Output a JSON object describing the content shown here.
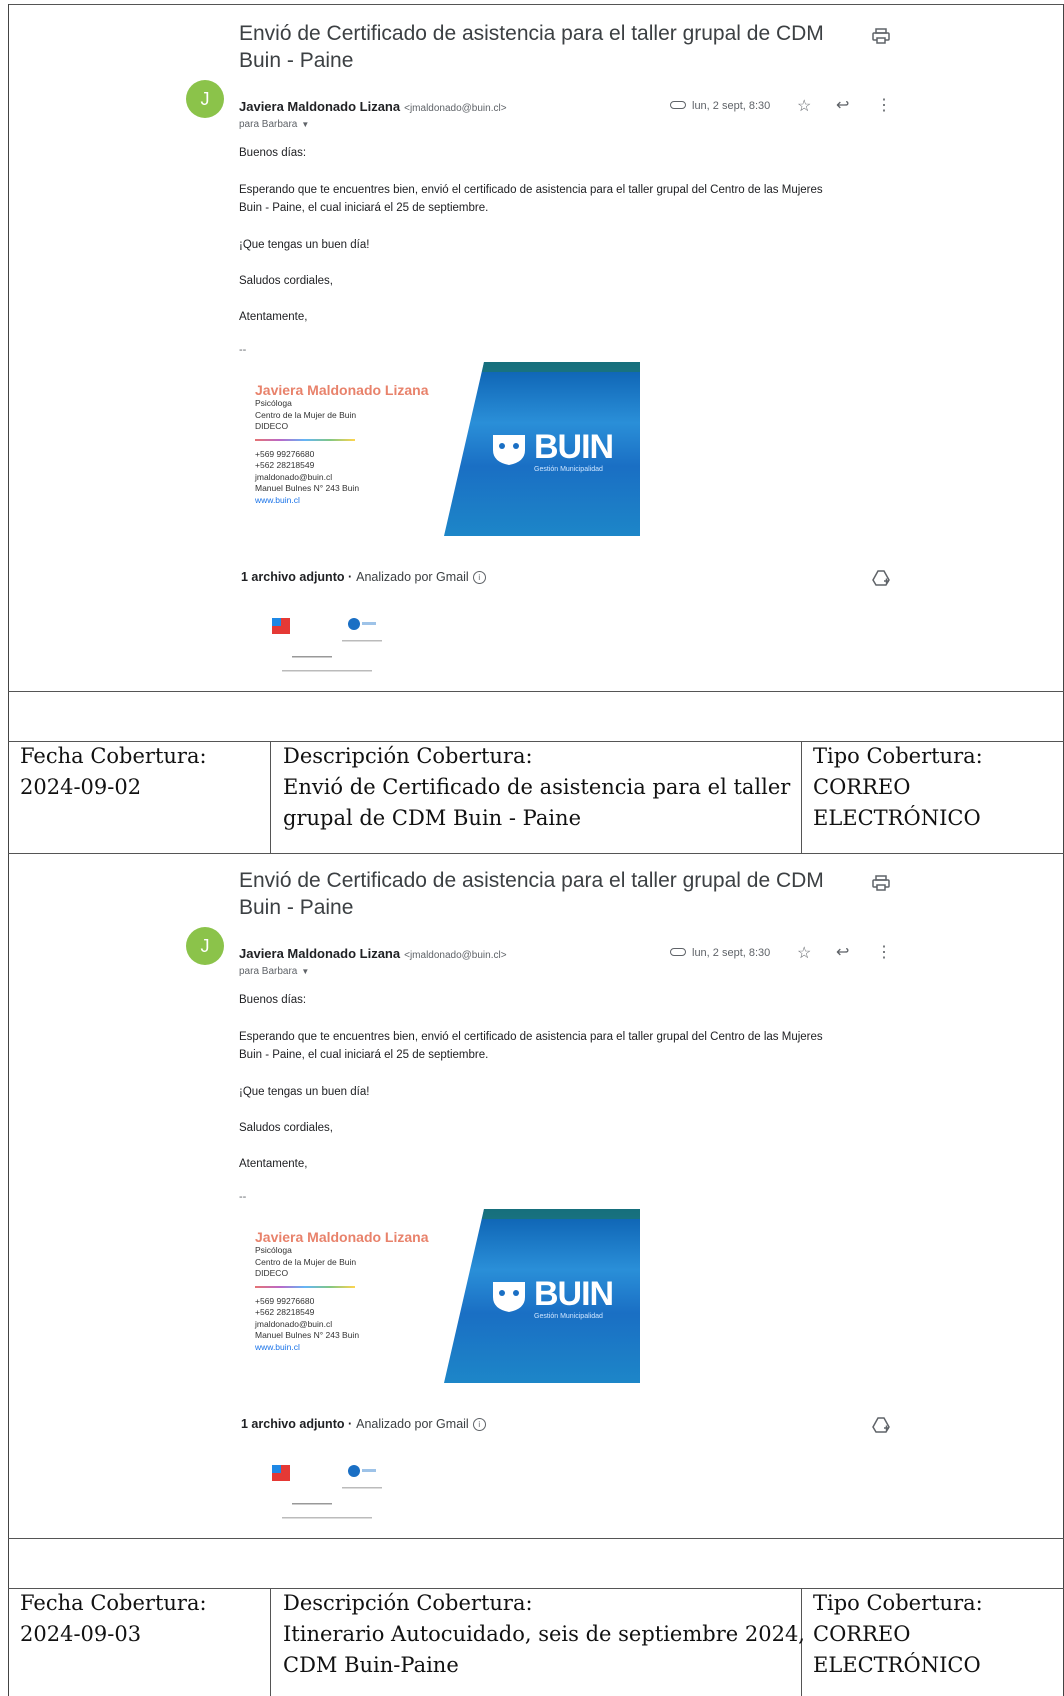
{
  "emails": [
    {
      "subject_line1": "Envió de Certificado de asistencia para el taller grupal de CDM",
      "subject_line2": "Buin - Paine",
      "avatar_letter": "J",
      "sender_name": "Javiera Maldonado Lizana",
      "sender_email": "<jmaldonado@buin.cl>",
      "recipient": "para Barbara",
      "date": "lun, 2 sept, 8:30",
      "greeting": "Buenos días:",
      "body_line1": "Esperando que te encuentres bien, envió el certificado de asistencia para el taller grupal del Centro de las Mujeres",
      "body_line2": "Buin - Paine, el cual iniciará el 25 de septiembre.",
      "wish": "¡Que tengas un buen día!",
      "regards": "Saludos cordiales,",
      "closing": "Atentamente,",
      "separator": "--",
      "signature": {
        "name": "Javiera Maldonado Lizana",
        "title": "Psicóloga",
        "org": "Centro de la Mujer de Buin",
        "dept": "DIDECO",
        "phone1": "+569 99276680",
        "phone2": "+562 28218549",
        "email": "jmaldonado@buin.cl",
        "address": "Manuel Bulnes N° 243 Buin",
        "web": "www.buin.cl"
      },
      "banner": {
        "brand": "BUIN",
        "subtitle": "Gestión Municipalidad"
      },
      "attachments_label": "1 archivo adjunto",
      "scanned_label": "Analizado por Gmail"
    },
    {
      "subject_line1": "Envió de Certificado de asistencia para el taller grupal de CDM",
      "subject_line2": "Buin - Paine",
      "avatar_letter": "J",
      "sender_name": "Javiera Maldonado Lizana",
      "sender_email": "<jmaldonado@buin.cl>",
      "recipient": "para Barbara",
      "date": "lun, 2 sept, 8:30",
      "greeting": "Buenos días:",
      "body_line1": "Esperando que te encuentres bien, envió el certificado de asistencia para el taller grupal del Centro de las Mujeres",
      "body_line2": "Buin - Paine, el cual iniciará el 25 de septiembre.",
      "wish": "¡Que tengas un buen día!",
      "regards": "Saludos cordiales,",
      "closing": "Atentamente,",
      "separator": "--",
      "signature": {
        "name": "Javiera Maldonado Lizana",
        "title": "Psicóloga",
        "org": "Centro de la Mujer de Buin",
        "dept": "DIDECO",
        "phone1": "+569 99276680",
        "phone2": "+562 28218549",
        "email": "jmaldonado@buin.cl",
        "address": "Manuel Bulnes N° 243 Buin",
        "web": "www.buin.cl"
      },
      "banner": {
        "brand": "BUIN",
        "subtitle": "Gestión Municipalidad"
      },
      "attachments_label": "1 archivo adjunto",
      "scanned_label": "Analizado por Gmail"
    }
  ],
  "coverage": [
    {
      "fecha_label": "Fecha Cobertura:",
      "fecha_value": "2024-09-02",
      "desc_label": "Descripción Cobertura:",
      "desc_line1": "Envió de Certificado de asistencia para el taller",
      "desc_line2": "grupal de CDM Buin - Paine",
      "tipo_label": "Tipo Cobertura:",
      "tipo_line1": "CORREO",
      "tipo_line2": "ELECTRÓNICO"
    },
    {
      "fecha_label": "Fecha Cobertura:",
      "fecha_value": "2024-09-03",
      "desc_label": "Descripción Cobertura:",
      "desc_line1": "Itinerario Autocuidado, seis de septiembre 2024,",
      "desc_line2": "CDM Buin-Paine",
      "tipo_label": "Tipo Cobertura:",
      "tipo_line1": "CORREO",
      "tipo_line2": "ELECTRÓNICO"
    }
  ],
  "colors": {
    "avatar": "#8bc34a",
    "signature_name": "#e8826b",
    "banner_blue": "#1e6fc0"
  }
}
